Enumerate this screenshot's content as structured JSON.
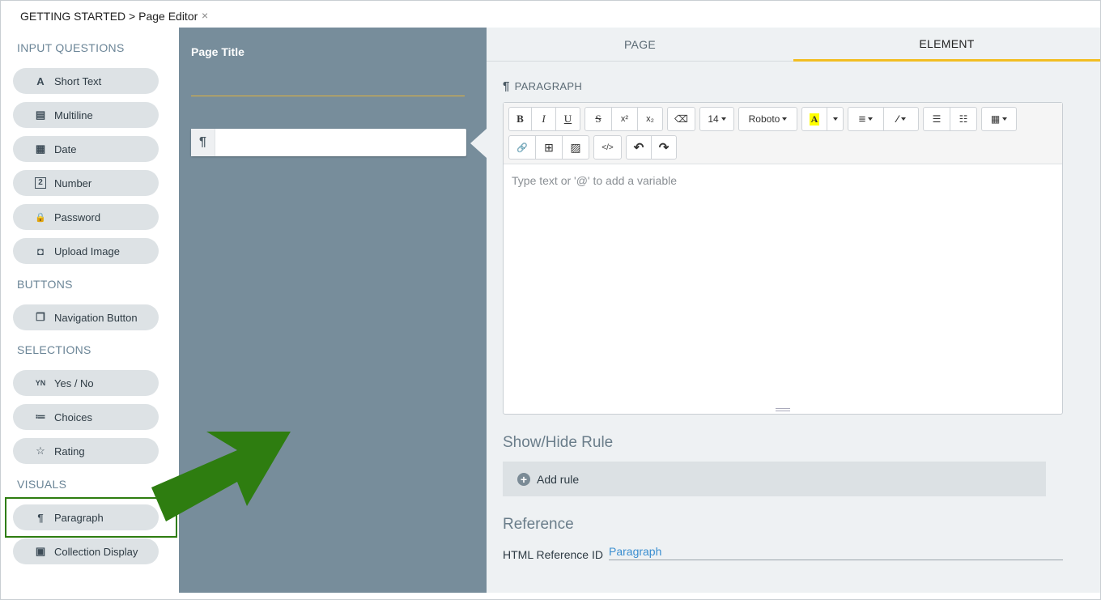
{
  "topbar": {
    "tab_label": "GETTING STARTED > Page Editor",
    "close_glyph": "×"
  },
  "sidebar": {
    "sections": {
      "input_questions": "INPUT QUESTIONS",
      "buttons": "BUTTONS",
      "selections": "SELECTIONS",
      "visuals": "VISUALS"
    },
    "items": {
      "short_text": {
        "label": "Short Text",
        "icon": "A"
      },
      "multiline": {
        "label": "Multiline",
        "icon": "▤"
      },
      "date": {
        "label": "Date",
        "icon": "▦"
      },
      "number": {
        "label": "Number",
        "icon": "2"
      },
      "password": {
        "label": "Password",
        "icon": "🔒"
      },
      "upload_image": {
        "label": "Upload Image",
        "icon": "◘"
      },
      "navigation_button": {
        "label": "Navigation Button",
        "icon": "❐"
      },
      "yes_no": {
        "label": "Yes / No",
        "icon": "YN"
      },
      "choices": {
        "label": "Choices",
        "icon": "≔"
      },
      "rating": {
        "label": "Rating",
        "icon": "☆"
      },
      "paragraph": {
        "label": "Paragraph",
        "icon": "¶"
      },
      "collection_display": {
        "label": "Collection Display",
        "icon": "▣"
      }
    }
  },
  "canvas": {
    "page_title_label": "Page Title",
    "paragraph_icon": "¶"
  },
  "panel": {
    "tabs": {
      "page": "PAGE",
      "element": "ELEMENT"
    },
    "section_header": "PARAGRAPH",
    "section_icon": "¶",
    "toolbar": {
      "bold": "B",
      "italic": "I",
      "underline": "U",
      "strike": "S",
      "superscript": "x²",
      "subscript": "x₂",
      "eraser": "⌫",
      "font_size": "14",
      "font_family": "Roboto",
      "color_letter": "A",
      "align": "≡",
      "magic": "⁄",
      "ul": "☰",
      "ol": "☷",
      "table": "▦",
      "link": "🔗",
      "insert": "⊞",
      "image": "▨",
      "code": "</>",
      "undo": "↶",
      "redo": "↷"
    },
    "editor_placeholder": "Type text or '@' to add a variable",
    "show_hide_title": "Show/Hide Rule",
    "add_rule_label": "Add rule",
    "add_rule_icon": "+",
    "reference_title": "Reference",
    "html_ref_label": "HTML Reference ID",
    "html_ref_value": "Paragraph"
  },
  "colors": {
    "accent": "#f2be22",
    "canvas_bg": "#778d9b",
    "highlight_green": "#2e7d10",
    "link_blue": "#3a8ed0"
  }
}
